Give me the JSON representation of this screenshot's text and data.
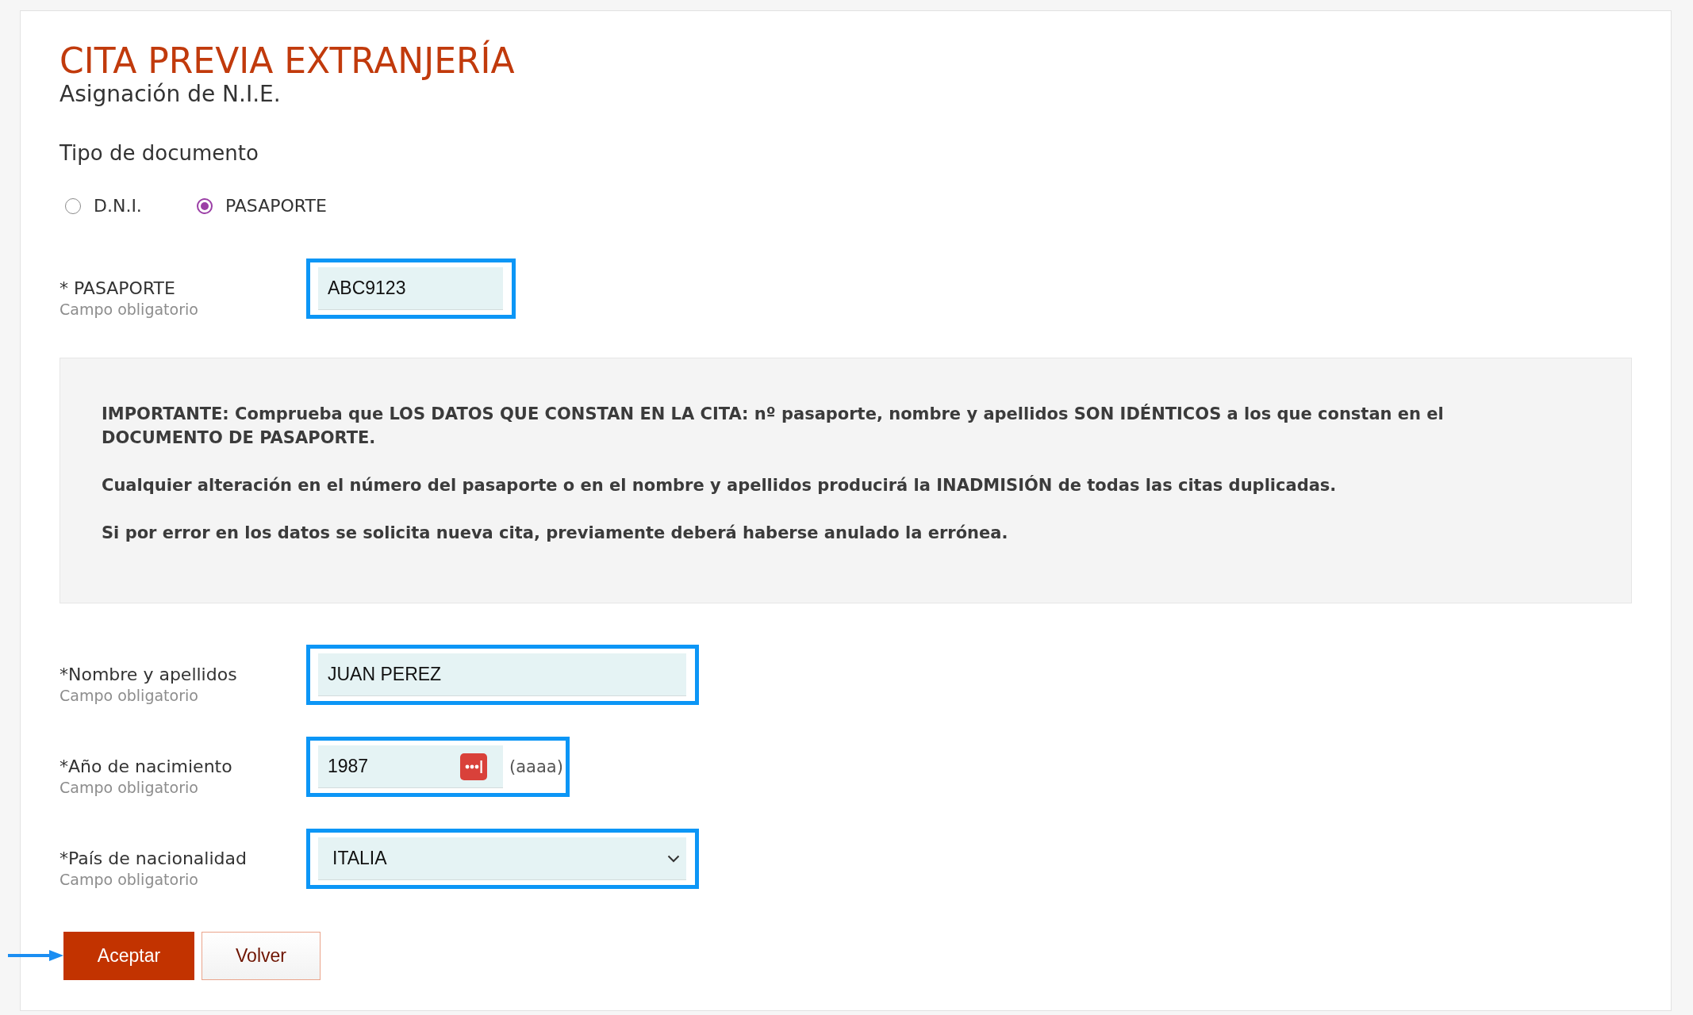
{
  "header": {
    "title": "CITA PREVIA EXTRANJERÍA",
    "subtitle": "Asignación de N.I.E."
  },
  "document_type": {
    "label": "Tipo de documento",
    "options": [
      {
        "label": "D.N.I.",
        "selected": false
      },
      {
        "label": "PASAPORTE",
        "selected": true
      }
    ]
  },
  "passport_field": {
    "kind": "text",
    "label": "* PASAPORTE",
    "hint": "Campo obligatorio",
    "value": "ABC9123",
    "highlighted": true
  },
  "notice": {
    "paragraphs": [
      "IMPORTANTE: Comprueba que LOS DATOS QUE CONSTAN EN LA CITA: nº pasaporte, nombre y apellidos SON IDÉNTICOS a los que constan en el DOCUMENTO DE PASAPORTE.",
      "Cualquier alteración en el número del pasaporte o en el nombre y apellidos producirá la INADMISIÓN de todas las citas duplicadas.",
      "Si por error en los datos se solicita nueva cita, previamente deberá haberse anulado la errónea."
    ]
  },
  "fields": [
    {
      "kind": "text",
      "label": "*Nombre y apellidos",
      "hint": "Campo obligatorio",
      "value": "JUAN PEREZ",
      "highlighted": true
    },
    {
      "kind": "year",
      "label": "*Año de nacimiento",
      "hint": "Campo obligatorio",
      "value": "1987",
      "format": "(aaaa)",
      "highlighted": true
    },
    {
      "kind": "select",
      "label": "*País de nacionalidad",
      "hint": "Campo obligatorio",
      "value": "ITALIA",
      "highlighted": true
    }
  ],
  "buttons": [
    {
      "kind": "primary",
      "label": "Aceptar",
      "arrow": true
    },
    {
      "kind": "secondary",
      "label": "Volver",
      "arrow": false
    }
  ]
}
